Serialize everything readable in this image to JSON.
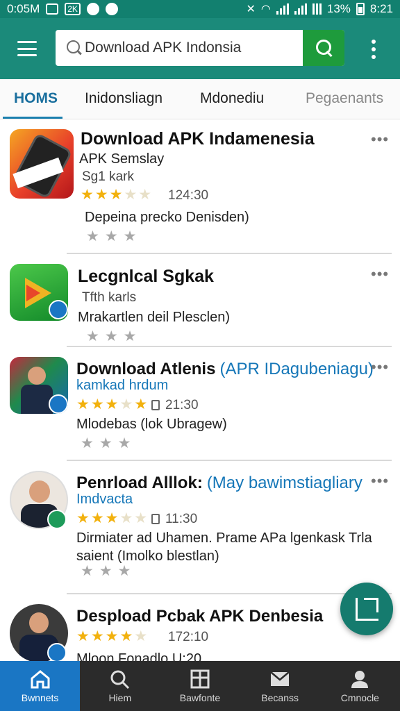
{
  "status": {
    "time": "0:05M",
    "notif_badge": "2K",
    "battery_pct": "13%",
    "clock": "8:21"
  },
  "appbar": {
    "search_value": "Download APK Indonsia"
  },
  "tabs": [
    "HOMS",
    "Inidonsliagn",
    "Mdonediu",
    "Pegaenants"
  ],
  "items": [
    {
      "title": "Download APK Indamenesia",
      "title_link": "",
      "sub": "APK Semslay",
      "meta": "Sg1 kark",
      "rating_text": "124:30",
      "desc": "Depeina precko Denisden)",
      "stars": 3
    },
    {
      "title": "Lecgnlcal Sgkak",
      "title_link": "",
      "sub": "",
      "meta": "Tfth karls",
      "rating_text": "",
      "desc": "Mrakartlen deil Plesclen)",
      "stars": 0
    },
    {
      "title": "Download Atlenis",
      "title_link": "(APR IDagubeniagu)",
      "sub": "kamkad hrdum",
      "meta": "",
      "rating_text": "21:30",
      "desc": "Mlodebas (lok Ubragew)",
      "stars": 4
    },
    {
      "title": "Penrload Alllok:",
      "title_link": "(May bawimstiagliary",
      "sub": "Imdvacta",
      "meta": "",
      "rating_text": "11:30",
      "desc": "Dirmiater ad Uhamen. Prame APa lgenkask Trla saient (Imolko blestlan)",
      "stars": 3
    },
    {
      "title": "Despload Pcbak APK Denbesia",
      "title_link": "",
      "sub": "",
      "meta": "",
      "rating_text": "172:10",
      "desc": "Mloon Fonadlo U:20",
      "stars": 4
    }
  ],
  "more_label": "•••",
  "bottom_nav": [
    "Bwnnets",
    "Hiem",
    "Bawfonte",
    "Becanss",
    "Cmnocle"
  ]
}
